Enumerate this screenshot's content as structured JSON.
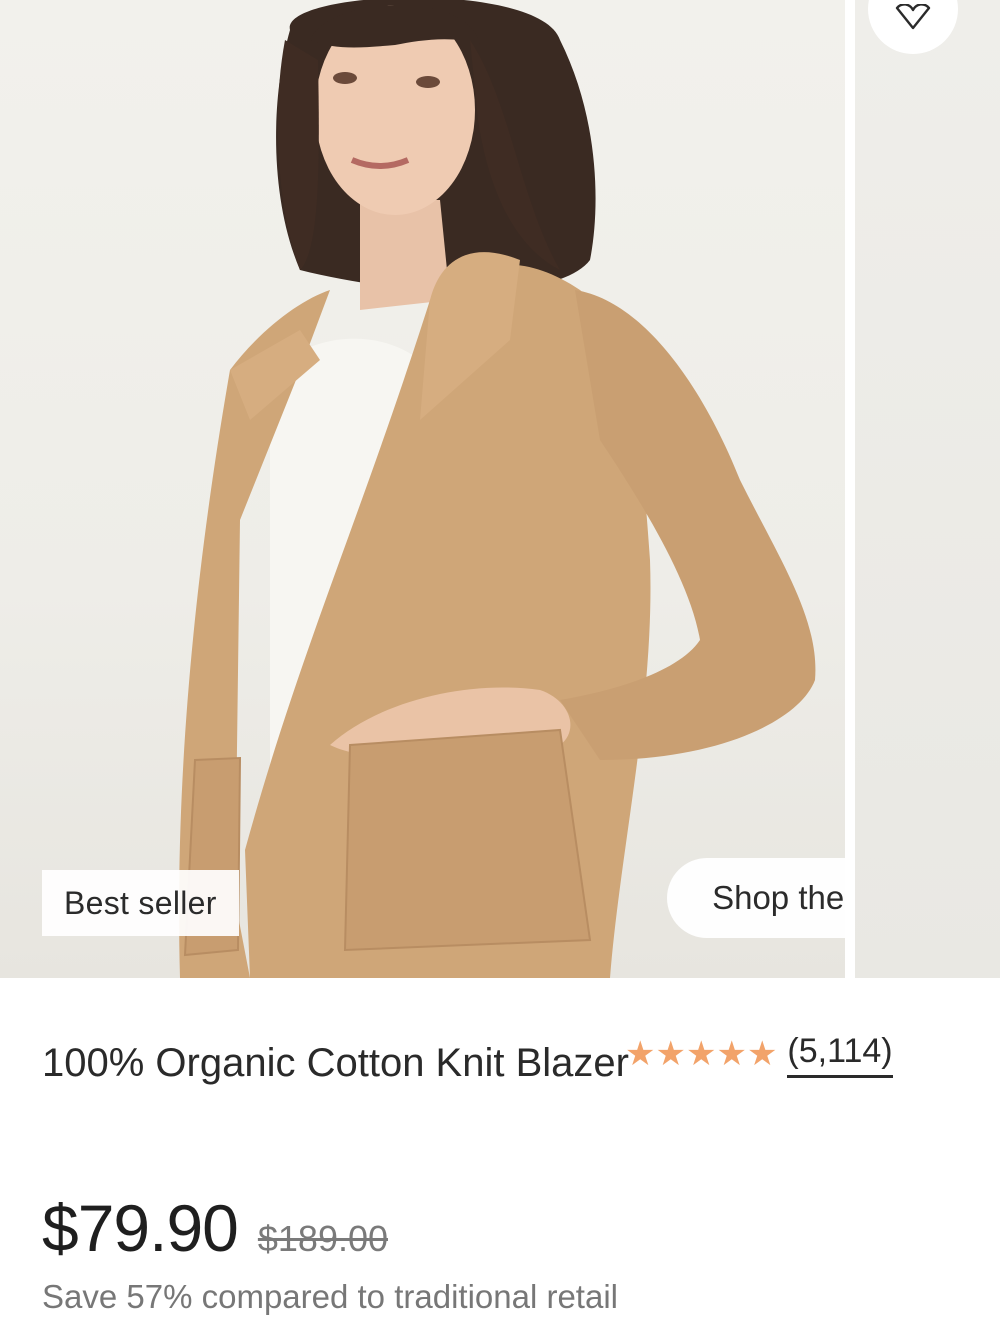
{
  "hero": {
    "badge_label": "Best seller",
    "shop_the_look_label": "Shop the look",
    "favorite_icon": "heart-outline-icon"
  },
  "product": {
    "title": "100% Organic Cotton Knit Blazer",
    "rating_stars": 5,
    "star_color": "#f2a36a",
    "review_count": "(5,114)",
    "price": "$79.90",
    "original_price": "$189.00",
    "savings_text": "Save 57% compared to traditional retail"
  }
}
